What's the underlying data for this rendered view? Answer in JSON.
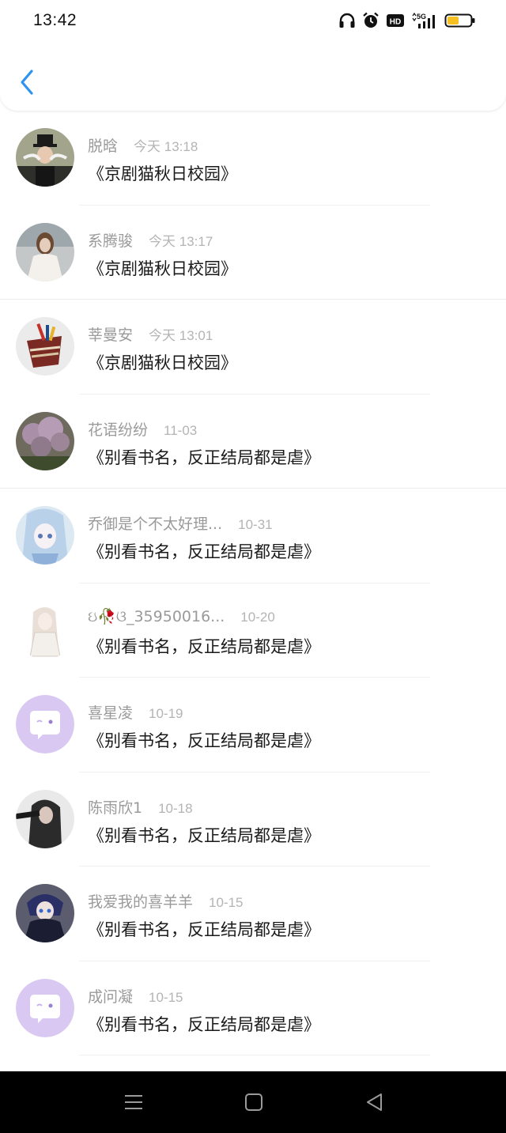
{
  "status_bar": {
    "time": "13:42",
    "network": "5G",
    "hd": "HD",
    "battery_level": 0.5
  },
  "header": {
    "back_icon": "chevron-left-icon",
    "accent": "#2f93f0"
  },
  "comments": [
    {
      "name": "脱晗",
      "date": "今天 13:18",
      "book": "《京剧猫秋日校园》"
    },
    {
      "name": "系腾骏",
      "date": "今天 13:17",
      "book": "《京剧猫秋日校园》"
    },
    {
      "name": "莘曼安",
      "date": "今天 13:01",
      "book": "《京剧猫秋日校园》"
    },
    {
      "name": "花语纷纷",
      "date": "11-03",
      "book": "《别看书名，反正结局都是虐》"
    },
    {
      "name": "乔御是个不太好理...",
      "date": "10-31",
      "book": "《别看书名，反正结局都是虐》"
    },
    {
      "name": "ઇ🥀ଓ_35950016...",
      "date": "10-20",
      "book": "《别看书名，反正结局都是虐》"
    },
    {
      "name": "喜星凌",
      "date": "10-19",
      "book": "《别看书名，反正结局都是虐》"
    },
    {
      "name": "陈雨欣1",
      "date": "10-18",
      "book": "《别看书名，反正结局都是虐》"
    },
    {
      "name": "我爱我的喜羊羊",
      "date": "10-15",
      "book": "《别看书名，反正结局都是虐》"
    },
    {
      "name": "成问凝",
      "date": "10-15",
      "book": "《别看书名，反正结局都是虐》"
    }
  ],
  "nav_bar": {
    "menu_icon": "menu-icon",
    "home_icon": "home-icon",
    "back_icon": "back-triangle-icon"
  }
}
